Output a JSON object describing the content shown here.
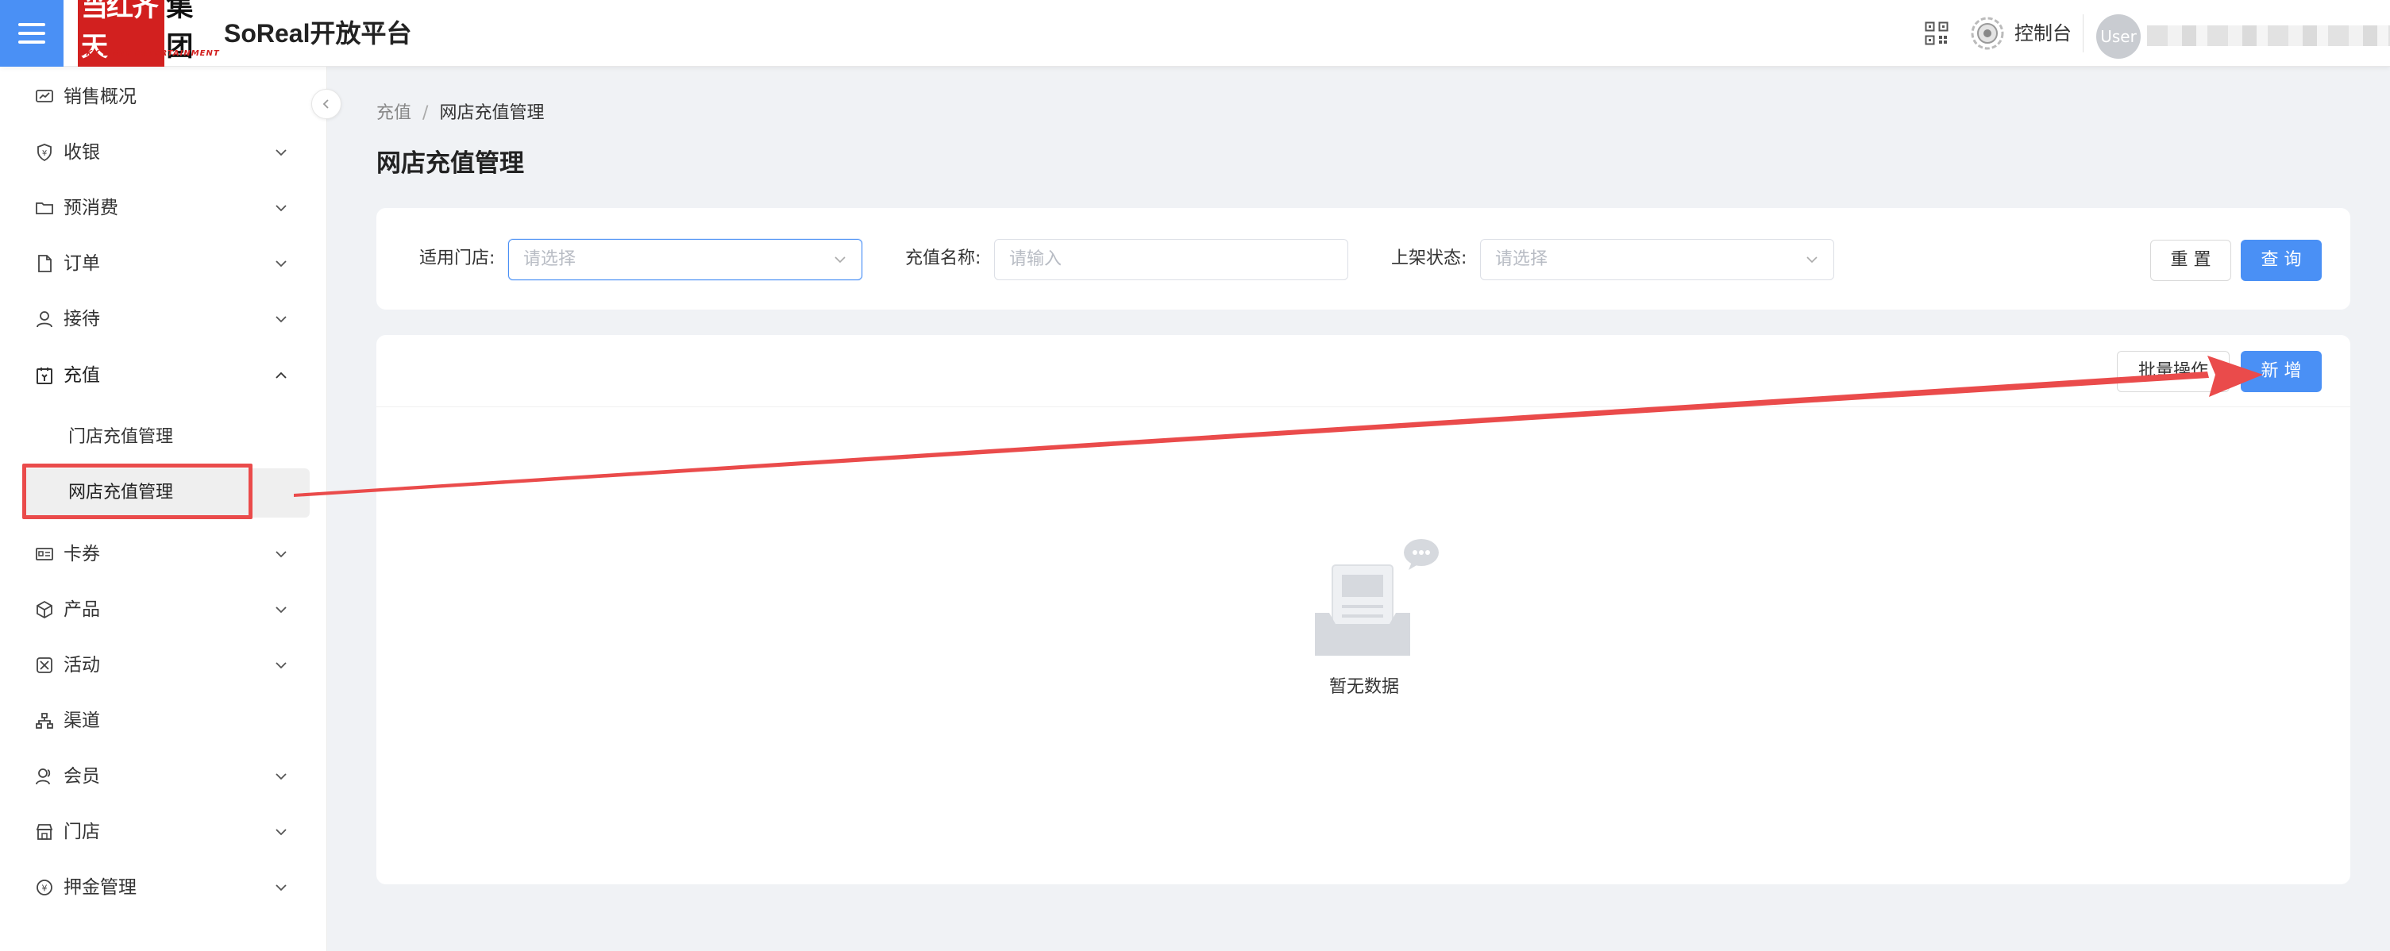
{
  "header": {
    "logo_text_red": "当红齐天",
    "logo_text_black": "集团",
    "logo_subtitle": "SKY LIMIT ENTERTAINMENT",
    "app_title": "SoReal开放平台",
    "console_label": "控制台",
    "avatar_text": "User"
  },
  "sidebar": {
    "items": [
      {
        "label": "销售概况",
        "icon": "sales-overview-icon",
        "has_arrow": false
      },
      {
        "label": "收银",
        "icon": "cashier-shield-icon",
        "has_arrow": true
      },
      {
        "label": "预消费",
        "icon": "folder-icon",
        "has_arrow": true
      },
      {
        "label": "订单",
        "icon": "document-icon",
        "has_arrow": true
      },
      {
        "label": "接待",
        "icon": "user-icon",
        "has_arrow": true
      },
      {
        "label": "充值",
        "icon": "recharge-icon",
        "has_arrow": true,
        "expanded": true
      },
      {
        "label": "卡券",
        "icon": "card-icon",
        "has_arrow": true
      },
      {
        "label": "产品",
        "icon": "product-cube-icon",
        "has_arrow": true
      },
      {
        "label": "活动",
        "icon": "activity-icon",
        "has_arrow": true
      },
      {
        "label": "渠道",
        "icon": "channel-icon",
        "has_arrow": false
      },
      {
        "label": "会员",
        "icon": "members-icon",
        "has_arrow": true
      },
      {
        "label": "门店",
        "icon": "store-icon",
        "has_arrow": true
      },
      {
        "label": "押金管理",
        "icon": "deposit-icon",
        "has_arrow": true
      }
    ],
    "sub_items": [
      {
        "label": "门店充值管理",
        "active": false
      },
      {
        "label": "网店充值管理",
        "active": true
      }
    ]
  },
  "breadcrumb": {
    "parent": "充值",
    "separator": "/",
    "current": "网店充值管理"
  },
  "page_title": "网店充值管理",
  "filters": {
    "store": {
      "label": "适用门店:",
      "placeholder": "请选择"
    },
    "name": {
      "label": "充值名称:",
      "placeholder": "请输入"
    },
    "status": {
      "label": "上架状态:",
      "placeholder": "请选择"
    },
    "reset_label": "重 置",
    "query_label": "查 询"
  },
  "list": {
    "batch_label": "批量操作",
    "add_label": "新 增",
    "empty_text": "暂无数据"
  },
  "colors": {
    "primary": "#4a90f5",
    "annotation": "#ea4b4b",
    "logo_red": "#d2201f"
  }
}
